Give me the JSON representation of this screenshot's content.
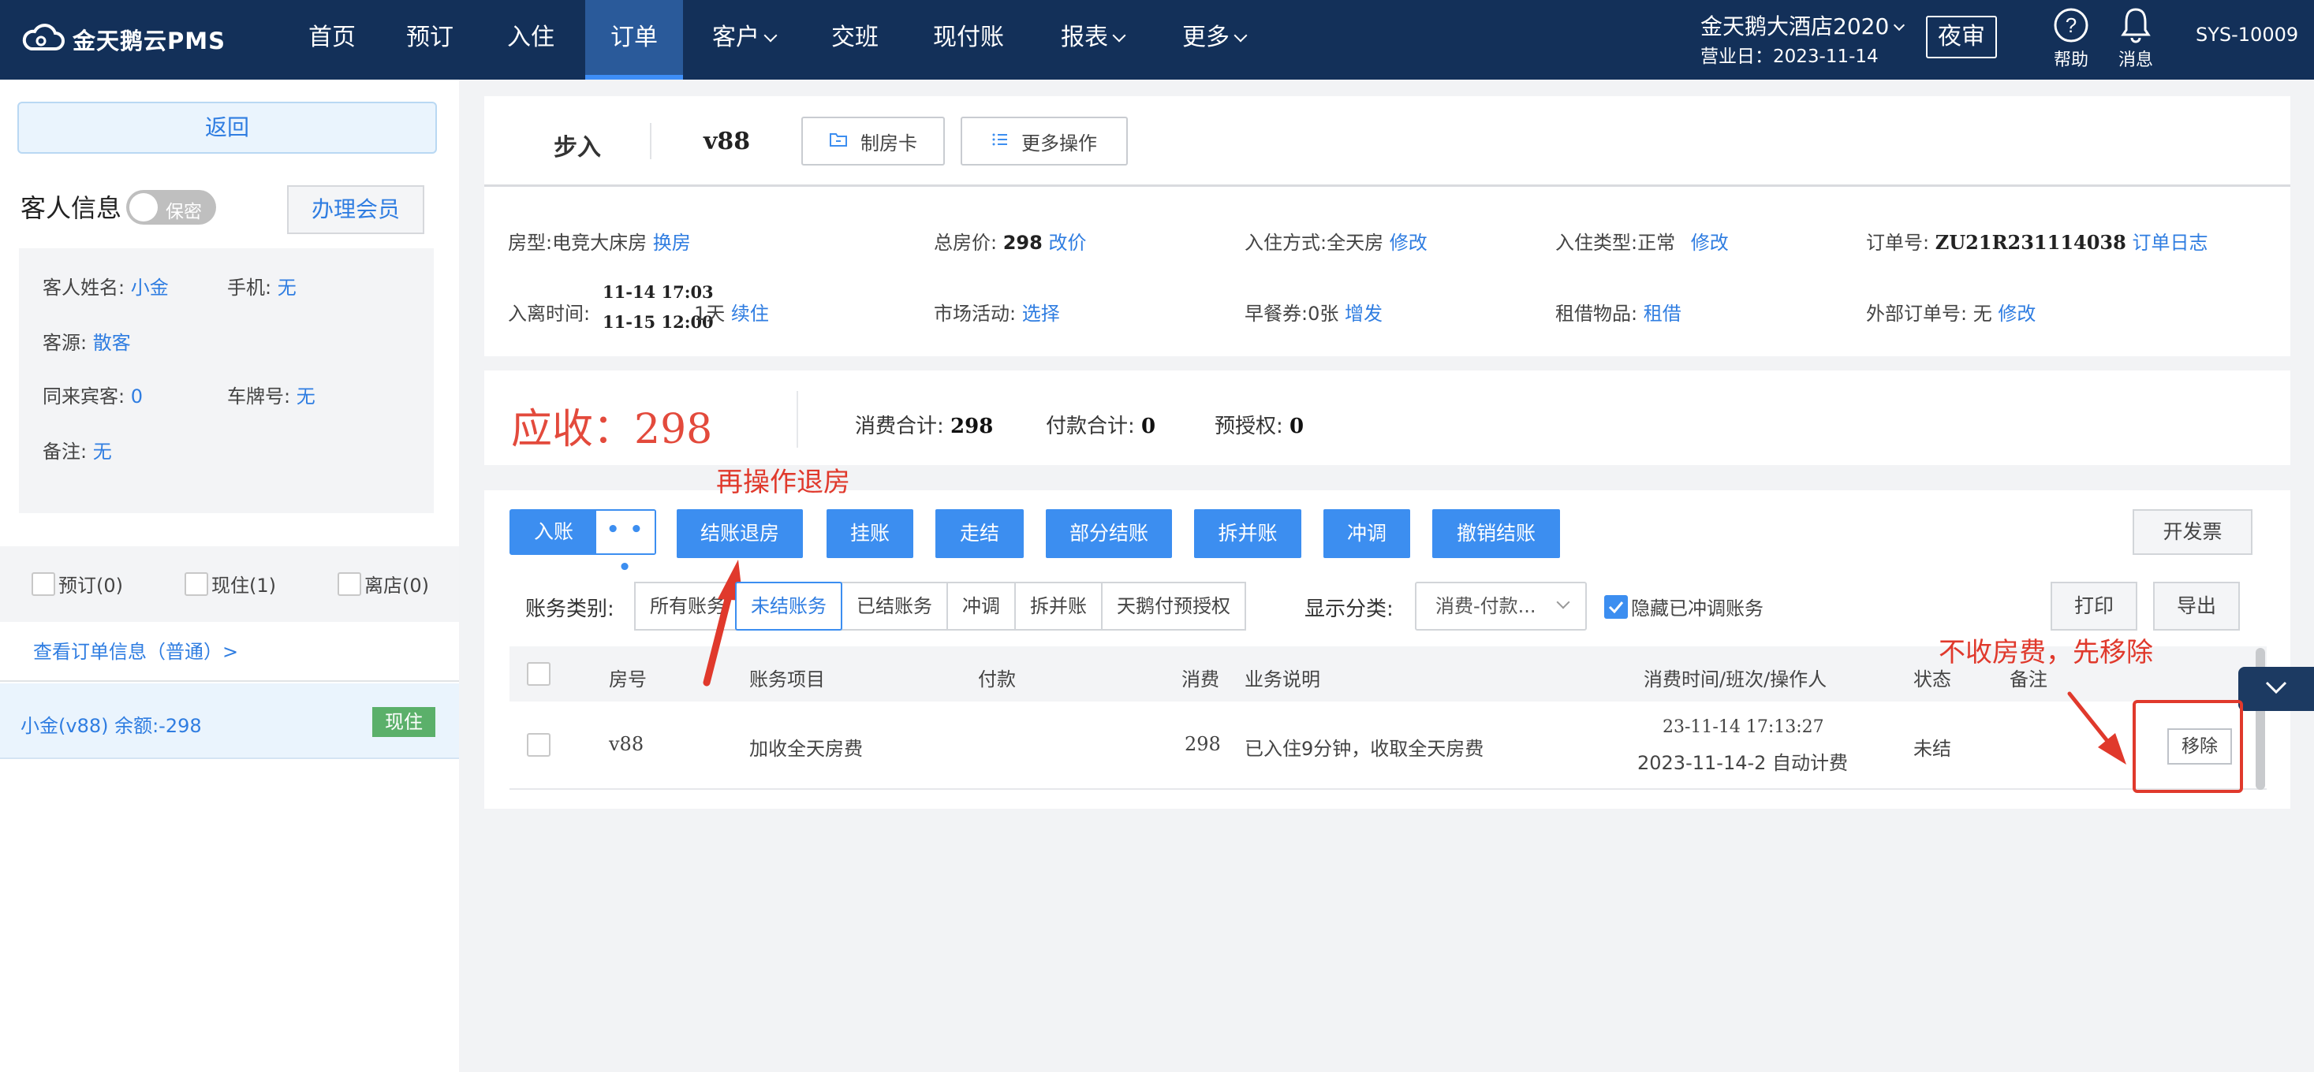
{
  "nav": {
    "logo": "金天鹅云PMS",
    "items": [
      {
        "label": "首页",
        "caret": false
      },
      {
        "label": "预订",
        "caret": false
      },
      {
        "label": "入住",
        "caret": false
      },
      {
        "label": "订单",
        "caret": false,
        "active": true
      },
      {
        "label": "客户",
        "caret": true
      },
      {
        "label": "交班",
        "caret": false
      },
      {
        "label": "现付账",
        "caret": false
      },
      {
        "label": "报表",
        "caret": true
      },
      {
        "label": "更多",
        "caret": true
      }
    ],
    "hotel": "金天鹅大酒店2020",
    "business_day": "营业日：2023-11-14",
    "night_audit": "夜审",
    "help": "帮助",
    "messages": "消息",
    "user": "SYS-10009"
  },
  "left": {
    "back": "返回",
    "guest_info_title": "客人信息",
    "privacy_toggle": "保密",
    "member_button": "办理会员",
    "guest": {
      "name_label": "客人姓名:",
      "name": "小金",
      "phone_label": "手机:",
      "phone": "无",
      "source_label": "客源:",
      "source": "散客",
      "companions_label": "同来宾客:",
      "companions": "0",
      "plate_label": "车牌号:",
      "plate": "无",
      "remark_label": "备注:",
      "remark": "无"
    },
    "status_filters": [
      "预订(0)",
      "现住(1)",
      "离店(0)"
    ],
    "order_link": "查看订单信息（普通）>",
    "room_entry": {
      "text": "小金(v88)   余额:-298",
      "badge": "现住"
    }
  },
  "order": {
    "status": "步入",
    "room": "v88",
    "make_card": "制房卡",
    "more_ops": "更多操作",
    "fields": {
      "room_type_label": "房型:",
      "room_type": "电竞大床房",
      "change_room": "换房",
      "total_label": "总房价:",
      "total": "298",
      "change_price": "改价",
      "checkin_mode_label": "入住方式:",
      "checkin_mode": "全天房",
      "modify": "修改",
      "checkin_type_label": "入住类型:",
      "checkin_type": "正常",
      "order_no_label": "订单号:",
      "order_no": "ZU21R231114038",
      "order_log": "订单日志",
      "stay_label": "入离时间:",
      "arrive": "11-14 17:03",
      "depart": "11-15 12:00",
      "nights": "1天",
      "extend": "续住",
      "market_label": "市场活动:",
      "select": "选择",
      "breakfast_label": "早餐券:",
      "breakfast": "0张",
      "add": "增发",
      "rental_label": "租借物品:",
      "rental": "租借",
      "ext_order_label": "外部订单号:",
      "ext_order": "无"
    }
  },
  "summary": {
    "due_label": "应收：",
    "due": "298",
    "consume_label": "消费合计:",
    "consume": "298",
    "pay_label": "付款合计:",
    "pay": "0",
    "preauth_label": "预授权:",
    "preauth": "0"
  },
  "ledger": {
    "post": "入账",
    "dots": "• • •",
    "buttons": [
      "结账退房",
      "挂账",
      "走结",
      "部分结账",
      "拆并账",
      "冲调",
      "撤销结账"
    ],
    "invoice": "开发票",
    "print": "打印",
    "export": "导出",
    "category_label": "账务类别:",
    "categories": [
      "所有账务",
      "未结账务",
      "已结账务",
      "冲调",
      "拆并账",
      "天鹅付预授权"
    ],
    "active_category": "未结账务",
    "display_label": "显示分类:",
    "display_value": "消费-付款...",
    "hide_reversed": "隐藏已冲调账务",
    "columns": [
      "房号",
      "账务项目",
      "付款",
      "消费",
      "业务说明",
      "消费时间/班次/操作人",
      "状态",
      "备注"
    ],
    "rows": [
      {
        "room": "v88",
        "item": "加收全天房费",
        "payment": "",
        "consume": "298",
        "desc": "已入住9分钟，收取全天房费",
        "time": "23-11-14 17:13:27",
        "shift": "2023-11-14-2 自动计费",
        "status": "未结",
        "remark": "",
        "action": "移除"
      }
    ]
  },
  "annotations": {
    "checkout": "再操作退房",
    "remove": "不收房费，先移除"
  },
  "colors": {
    "nav_bg": "#133059",
    "primary": "#3c8ef0",
    "link": "#2f7de1",
    "due": "#e34a3c",
    "annotation": "#e0392c"
  }
}
